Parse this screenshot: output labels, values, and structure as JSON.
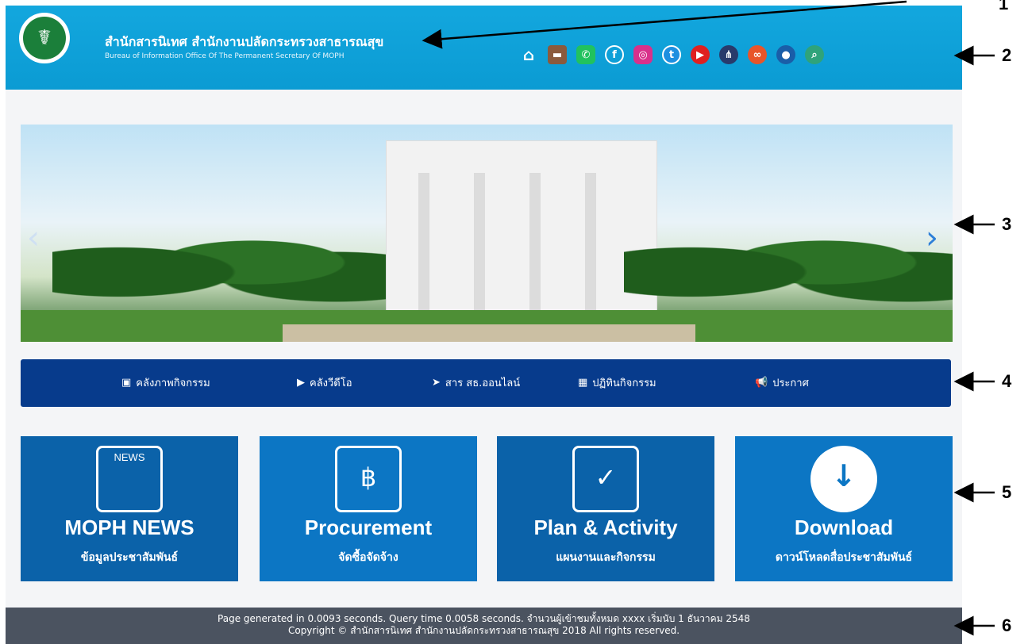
{
  "header": {
    "title": "สำนักสารนิเทศ  สำนักงานปลัดกระทรวงสาธารณสุข",
    "subtitle": "Bureau of Information  Office Of The Permanent Secretary Of MOPH",
    "icons": [
      "home-icon",
      "briefcase-icon",
      "phone-icon",
      "facebook-icon",
      "instagram-icon",
      "twitter-icon",
      "youtube-icon",
      "sitemap-icon",
      "link-icon",
      "user-icon",
      "search-icon"
    ]
  },
  "nav": {
    "items": [
      {
        "label": "คลังภาพกิจกรรม",
        "icon": "image-icon"
      },
      {
        "label": "คลังวีดีโอ",
        "icon": "video-icon"
      },
      {
        "label": "สาร สธ.ออนไลน์",
        "icon": "send-icon"
      },
      {
        "label": "ปฏิทินกิจกรรม",
        "icon": "calendar-icon"
      },
      {
        "label": "ประกาศ",
        "icon": "megaphone-icon"
      }
    ]
  },
  "cards": [
    {
      "title": "MOPH NEWS",
      "subtitle": "ข้อมูลประชาสัมพันธ์",
      "icon": "news-icon",
      "badge": "NEWS",
      "color": "#0b62a9"
    },
    {
      "title": "Procurement",
      "subtitle": "จัดซื้อจัดจ้าง",
      "icon": "procurement-icon",
      "badge": "฿",
      "color": "#0c76c4"
    },
    {
      "title": "Plan & Activity",
      "subtitle": "แผนงานและกิจกรรม",
      "icon": "calendar-check-icon",
      "badge": "✓",
      "color": "#0b62a9"
    },
    {
      "title": "Download",
      "subtitle": "ดาวน์โหลดสื่อประชาสัมพันธ์",
      "icon": "cloud-download-icon",
      "badge": "↓",
      "color": "#0c76c4"
    }
  ],
  "footer": {
    "line1": "Page generated in 0.0093 seconds. Query time 0.0058 seconds.   จำนวนผู้เข้าชมทั้งหมด xxxx เริ่มนับ 1 ธันวาคม 2548",
    "line2": "Copyright © สำนักสารนิเทศ สำนักงานปลัดกระทรวงสาธารณสุข 2018 All rights reserved."
  },
  "annotations": [
    "1",
    "2",
    "3",
    "4",
    "5",
    "6"
  ],
  "colors": {
    "header": "#0b9bd3",
    "nav": "#073b8c",
    "footer": "#4b5360"
  }
}
